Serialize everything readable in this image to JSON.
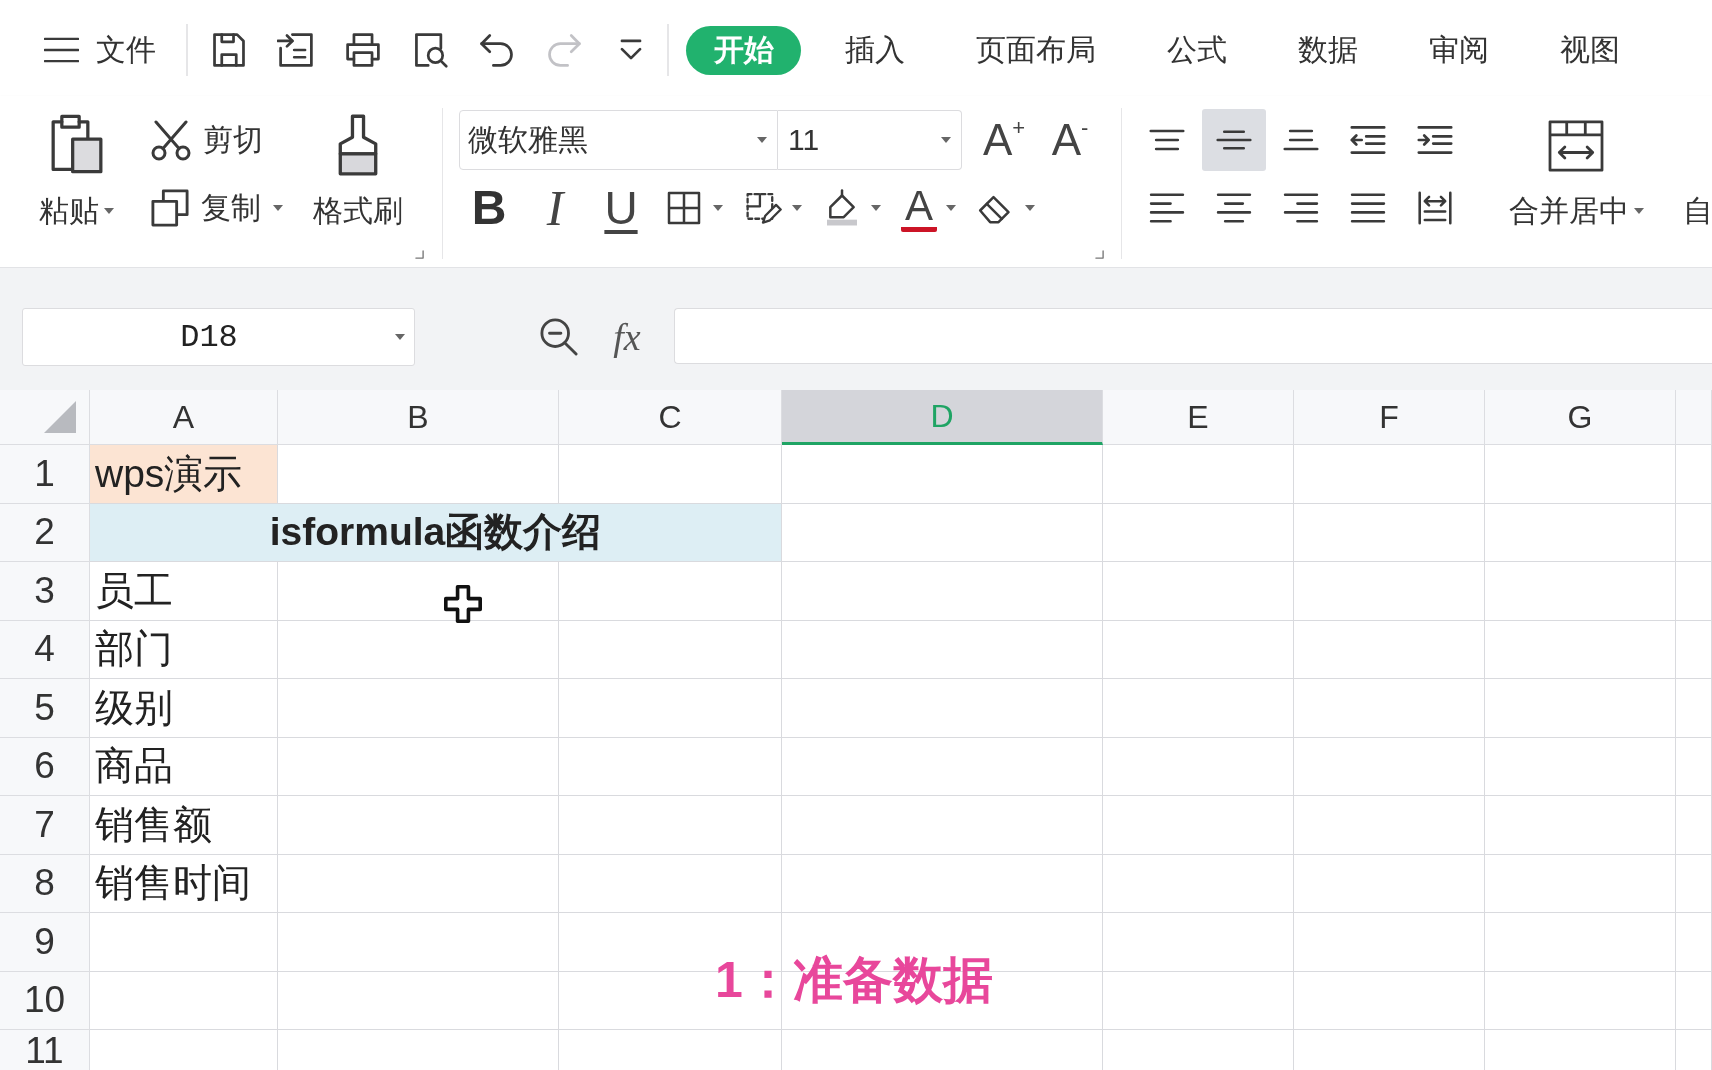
{
  "menu_bar": {
    "file_menu": "文件",
    "tabs": [
      {
        "label": "开始",
        "selected": true
      },
      {
        "label": "插入",
        "selected": false
      },
      {
        "label": "页面布局",
        "selected": false
      },
      {
        "label": "公式",
        "selected": false
      },
      {
        "label": "数据",
        "selected": false
      },
      {
        "label": "审阅",
        "selected": false
      },
      {
        "label": "视图",
        "selected": false
      }
    ]
  },
  "quick_access": [
    {
      "kind": "save",
      "disabled": false
    },
    {
      "kind": "export",
      "disabled": false
    },
    {
      "kind": "print",
      "disabled": false
    },
    {
      "kind": "print_preview",
      "disabled": false
    },
    {
      "kind": "undo",
      "disabled": false
    },
    {
      "kind": "redo",
      "disabled": true
    },
    {
      "kind": "customize",
      "disabled": false
    }
  ],
  "ribbon": {
    "clipboard": {
      "paste": "粘贴",
      "cut": "剪切",
      "copy": "复制",
      "format_painter": "格式刷"
    },
    "font": {
      "name": "微软雅黑",
      "size": "11",
      "grow": "A$^{+}$",
      "shrink": "A$^{-}$",
      "buttons": [
        {
          "kind": "bold",
          "glyph": "B"
        },
        {
          "kind": "italic",
          "glyph": "I"
        },
        {
          "kind": "underline",
          "glyph": "U"
        },
        {
          "kind": "borders"
        },
        {
          "kind": "cell_style"
        },
        {
          "kind": "fill_color"
        },
        {
          "kind": "font_color",
          "glyph": "A"
        },
        {
          "kind": "clear"
        }
      ]
    },
    "alignment": {
      "vertical": [
        {
          "kind": "top",
          "selected": false
        },
        {
          "kind": "middle",
          "selected": true
        },
        {
          "kind": "bottom",
          "selected": false
        },
        {
          "kind": "outdent",
          "selected": false
        },
        {
          "kind": "indent",
          "selected": false
        }
      ],
      "horizontal": [
        {
          "kind": "left",
          "selected": false
        },
        {
          "kind": "center",
          "selected": false
        },
        {
          "kind": "right",
          "selected": false
        },
        {
          "kind": "justify",
          "selected": false
        },
        {
          "kind": "distributed",
          "selected": false
        }
      ]
    },
    "merge": "合并居中",
    "next_group": "自"
  },
  "formula_bar": {
    "name_box": "D18",
    "function_label": "fx"
  },
  "sheet": {
    "columns": [
      {
        "label": "A",
        "selected": false
      },
      {
        "label": "B",
        "selected": false
      },
      {
        "label": "C",
        "selected": false
      },
      {
        "label": "D",
        "selected": true
      },
      {
        "label": "E",
        "selected": false
      },
      {
        "label": "F",
        "selected": false
      },
      {
        "label": "G",
        "selected": false
      }
    ],
    "rows": [
      {
        "label": "1",
        "cells": [
          {
            "kind": "text",
            "text": "wps演示",
            "color": "#fce4d3"
          }
        ]
      },
      {
        "label": "2",
        "cells": [
          {
            "kind": "title",
            "text": "isformula函数介绍",
            "color": "#ddeef4"
          }
        ]
      },
      {
        "label": "3",
        "cells": [
          {
            "kind": "text",
            "text": "员工"
          }
        ]
      },
      {
        "label": "4",
        "cells": [
          {
            "kind": "text",
            "text": "部门"
          }
        ]
      },
      {
        "label": "5",
        "cells": [
          {
            "kind": "text",
            "text": "级别"
          }
        ]
      },
      {
        "label": "6",
        "cells": [
          {
            "kind": "text",
            "text": "商品"
          }
        ]
      },
      {
        "label": "7",
        "cells": [
          {
            "kind": "text",
            "text": "销售额"
          }
        ]
      },
      {
        "label": "8",
        "cells": [
          {
            "kind": "text",
            "text": "销售时间"
          }
        ]
      },
      {
        "label": "9"
      },
      {
        "label": "10"
      },
      {
        "label": "11"
      }
    ]
  },
  "caption": "1：准备数据"
}
